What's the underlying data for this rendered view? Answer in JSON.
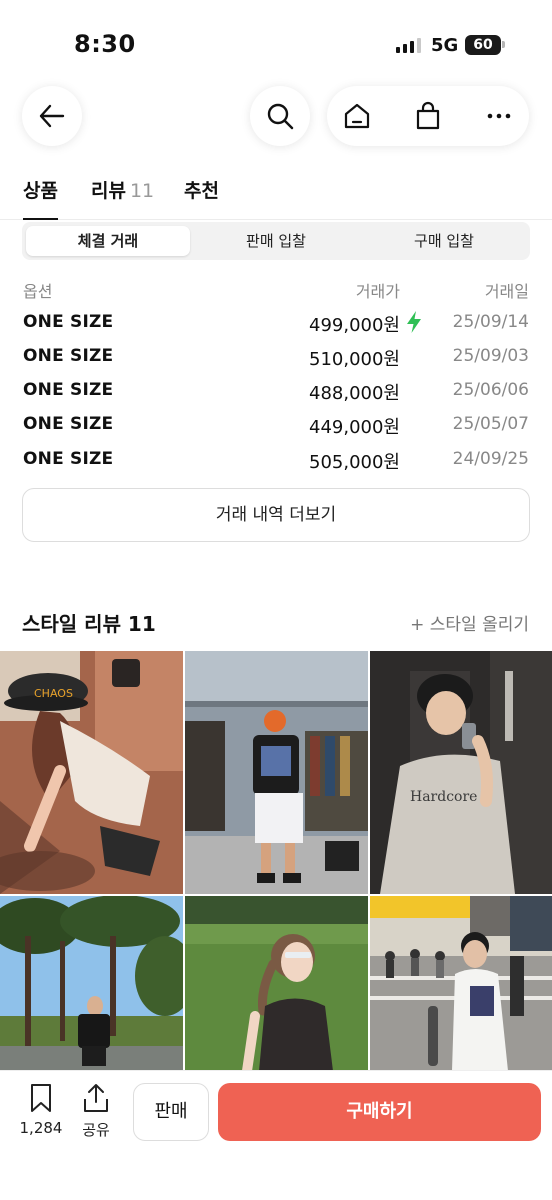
{
  "status_bar": {
    "time": "8:30",
    "network": "5G",
    "battery": "60"
  },
  "tabs": [
    {
      "label": "상품"
    },
    {
      "label": "리뷰",
      "count": "11"
    },
    {
      "label": "추천"
    }
  ],
  "segments": [
    "체결 거래",
    "판매 입찰",
    "구매 입찰"
  ],
  "table": {
    "headers": {
      "option": "옵션",
      "price": "거래가",
      "date": "거래일"
    },
    "rows": [
      {
        "option": "ONE SIZE",
        "price": "499,000원",
        "date": "25/09/14",
        "fast_delivery": true
      },
      {
        "option": "ONE SIZE",
        "price": "510,000원",
        "date": "25/09/03"
      },
      {
        "option": "ONE SIZE",
        "price": "488,000원",
        "date": "25/06/06"
      },
      {
        "option": "ONE SIZE",
        "price": "449,000원",
        "date": "25/05/07"
      },
      {
        "option": "ONE SIZE",
        "price": "505,000원",
        "date": "24/09/25"
      }
    ],
    "more_label": "거래 내역 더보기"
  },
  "style_review": {
    "title": "스타일 리뷰 11",
    "upload_label": "+ 스타일 올리기"
  },
  "bottom_bar": {
    "bookmark_count": "1,284",
    "share_label": "공유",
    "sell_label": "판매",
    "buy_label": "구매하기"
  },
  "colors": {
    "buy": "#ef6253",
    "bolt": "#2fbf55",
    "active_tab": "#111111"
  }
}
